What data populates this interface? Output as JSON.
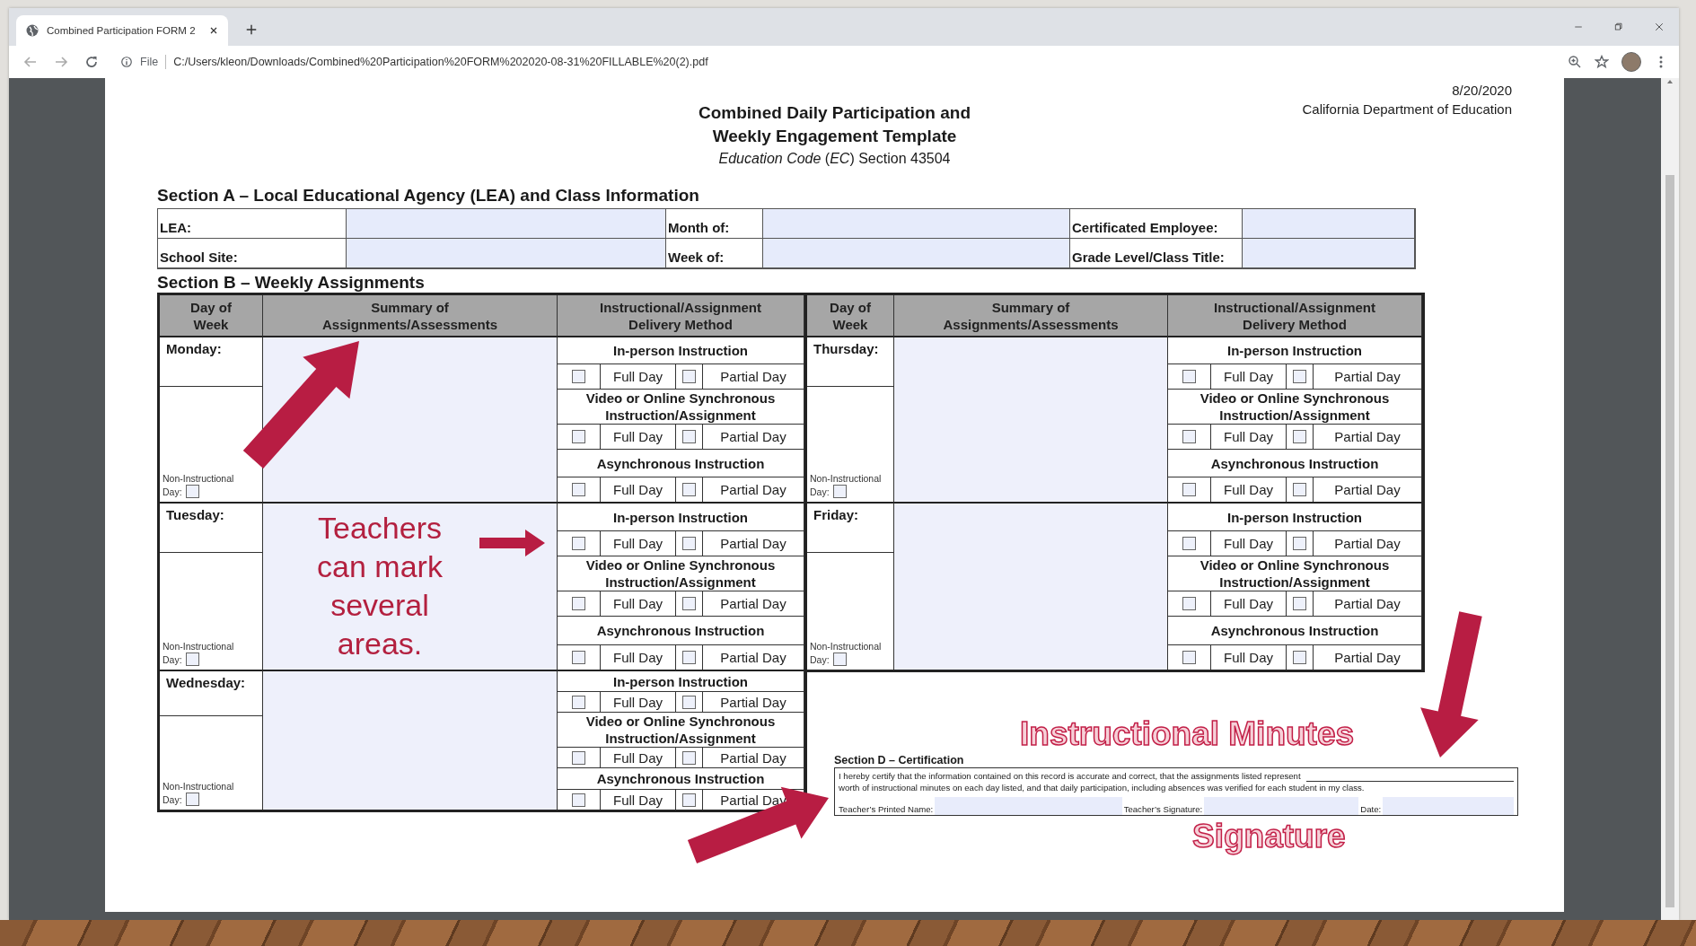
{
  "browser": {
    "tab": {
      "title": "Combined Participation FORM 2"
    },
    "address": {
      "scheme_label": "File",
      "url": "C:/Users/kleon/Downloads/Combined%20Participation%20FORM%202020-08-31%20FILLABLE%20(2).pdf"
    }
  },
  "document": {
    "date": "8/20/2020",
    "organization": "California Department of Education",
    "title_lines": [
      "Combined Daily Participation and",
      "Weekly Engagement Template"
    ],
    "subtitle": "*Education Code* (*EC*) Section 43504",
    "section_a": {
      "heading": "Section A – Local Educational Agency (LEA) and Class Information",
      "rows": [
        {
          "fields": [
            {
              "label": "LEA:"
            },
            {
              "label": "Month of:"
            },
            {
              "label": "Certificated Employee:"
            }
          ]
        },
        {
          "fields": [
            {
              "label": "School Site:"
            },
            {
              "label": "Week of:"
            },
            {
              "label": "Grade Level/Class Title:"
            }
          ]
        }
      ]
    },
    "section_b": {
      "heading": "Section B – Weekly Assignments",
      "halves": [
        {
          "columns": [
            "Day of Week",
            "Summary of Assignments/Assessments",
            "Instructional/Assignment Delivery Method"
          ],
          "days": [
            {
              "name": "Monday:",
              "non_instructional_label": "Non-Instructional",
              "day_label": "Day:",
              "non_instructional_checked": false,
              "methods": [
                {
                  "title": "In-person Instruction",
                  "options": [
                    {
                      "label": "Full Day",
                      "checked": false
                    },
                    {
                      "label": "Partial Day",
                      "checked": false
                    }
                  ]
                },
                {
                  "title": "Video or Online Synchronous Instruction/Assignment",
                  "options": [
                    {
                      "label": "Full Day",
                      "checked": false
                    },
                    {
                      "label": "Partial Day",
                      "checked": false
                    }
                  ]
                },
                {
                  "title": "Asynchronous Instruction",
                  "options": [
                    {
                      "label": "Full Day",
                      "checked": false
                    },
                    {
                      "label": "Partial Day",
                      "checked": false
                    }
                  ]
                }
              ]
            },
            {
              "name": "Tuesday:",
              "non_instructional_label": "Non-Instructional",
              "day_label": "Day:",
              "non_instructional_checked": false,
              "methods": [
                {
                  "title": "In-person Instruction",
                  "options": [
                    {
                      "label": "Full Day",
                      "checked": false
                    },
                    {
                      "label": "Partial Day",
                      "checked": false
                    }
                  ]
                },
                {
                  "title": "Video or Online Synchronous Instruction/Assignment",
                  "options": [
                    {
                      "label": "Full Day",
                      "checked": false
                    },
                    {
                      "label": "Partial Day",
                      "checked": false
                    }
                  ]
                },
                {
                  "title": "Asynchronous Instruction",
                  "options": [
                    {
                      "label": "Full Day",
                      "checked": false
                    },
                    {
                      "label": "Partial Day",
                      "checked": false
                    }
                  ]
                }
              ]
            },
            {
              "name": "Wednesday:",
              "non_instructional_label": "Non-Instructional",
              "day_label": "Day:",
              "non_instructional_checked": false,
              "methods": [
                {
                  "title": "In-person Instruction",
                  "options": [
                    {
                      "label": "Full Day",
                      "checked": false
                    },
                    {
                      "label": "Partial Day",
                      "checked": false
                    }
                  ]
                },
                {
                  "title": "Video or Online Synchronous Instruction/Assignment",
                  "options": [
                    {
                      "label": "Full Day",
                      "checked": false
                    },
                    {
                      "label": "Partial Day",
                      "checked": false
                    }
                  ]
                },
                {
                  "title": "Asynchronous Instruction",
                  "options": [
                    {
                      "label": "Full Day",
                      "checked": false
                    },
                    {
                      "label": "Partial Day",
                      "checked": false
                    }
                  ]
                }
              ]
            }
          ]
        },
        {
          "columns": [
            "Day of Week",
            "Summary of Assignments/Assessments",
            "Instructional/Assignment Delivery Method"
          ],
          "days": [
            {
              "name": "Thursday:",
              "non_instructional_label": "Non-Instructional",
              "day_label": "Day:",
              "non_instructional_checked": false,
              "methods": [
                {
                  "title": "In-person Instruction",
                  "options": [
                    {
                      "label": "Full Day",
                      "checked": false
                    },
                    {
                      "label": "Partial Day",
                      "checked": false
                    }
                  ]
                },
                {
                  "title": "Video or Online Synchronous Instruction/Assignment",
                  "options": [
                    {
                      "label": "Full Day",
                      "checked": false
                    },
                    {
                      "label": "Partial Day",
                      "checked": false
                    }
                  ]
                },
                {
                  "title": "Asynchronous Instruction",
                  "options": [
                    {
                      "label": "Full Day",
                      "checked": false
                    },
                    {
                      "label": "Partial Day",
                      "checked": false
                    }
                  ]
                }
              ]
            },
            {
              "name": "Friday:",
              "non_instructional_label": "Non-Instructional",
              "day_label": "Day:",
              "non_instructional_checked": false,
              "methods": [
                {
                  "title": "In-person Instruction",
                  "options": [
                    {
                      "label": "Full Day",
                      "checked": false
                    },
                    {
                      "label": "Partial Day",
                      "checked": false
                    }
                  ]
                },
                {
                  "title": "Video or Online Synchronous Instruction/Assignment",
                  "options": [
                    {
                      "label": "Full Day",
                      "checked": false
                    },
                    {
                      "label": "Partial Day",
                      "checked": false
                    }
                  ]
                },
                {
                  "title": "Asynchronous Instruction",
                  "options": [
                    {
                      "label": "Full Day",
                      "checked": false
                    },
                    {
                      "label": "Partial Day",
                      "checked": false
                    }
                  ]
                }
              ]
            }
          ]
        }
      ]
    },
    "section_d": {
      "heading": "Section D – Certification",
      "statement_before": "I hereby certify that the information contained on this record is accurate and correct, that the assignments listed represent",
      "statement_after": "worth of instructional minutes on each day listed, and that daily participation, including absences was verified for each student in my class.",
      "signature_fields": [
        {
          "label": "Teacher’s Printed Name:"
        },
        {
          "label": "Teacher’s Signature:"
        },
        {
          "label": "Date:"
        }
      ]
    },
    "annotations": [
      {
        "kind": "teacher_note",
        "text": "Teachers can mark several areas."
      },
      {
        "kind": "minutes_label",
        "text": "Instructional Minutes"
      },
      {
        "kind": "signature_label",
        "text": "Signature"
      }
    ]
  }
}
